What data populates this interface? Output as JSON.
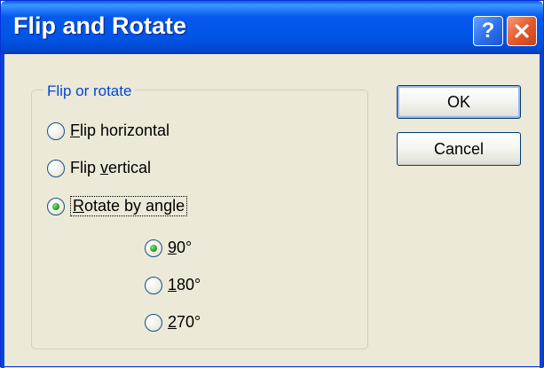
{
  "window": {
    "title": "Flip and Rotate"
  },
  "titlebar": {
    "help_label": "?",
    "close_icon": "close-icon"
  },
  "group": {
    "legend": "Flip or rotate",
    "options": [
      {
        "prefix": "",
        "mnemonic": "F",
        "rest": "lip horizontal",
        "checked": false
      },
      {
        "prefix": "Flip ",
        "mnemonic": "v",
        "rest": "ertical",
        "checked": false
      },
      {
        "prefix": "",
        "mnemonic": "R",
        "rest": "otate by angle",
        "checked": true
      }
    ],
    "angles": [
      {
        "mnemonic": "9",
        "rest": "0°",
        "checked": true
      },
      {
        "mnemonic": "1",
        "rest": "80°",
        "checked": false
      },
      {
        "mnemonic": "2",
        "rest": "70°",
        "checked": false
      }
    ]
  },
  "buttons": {
    "ok": "OK",
    "cancel": "Cancel"
  },
  "colors": {
    "titlebar": "#0155E5",
    "face": "#ECE9D8",
    "legend": "#0046D5",
    "radio_dot": "#21A121"
  }
}
